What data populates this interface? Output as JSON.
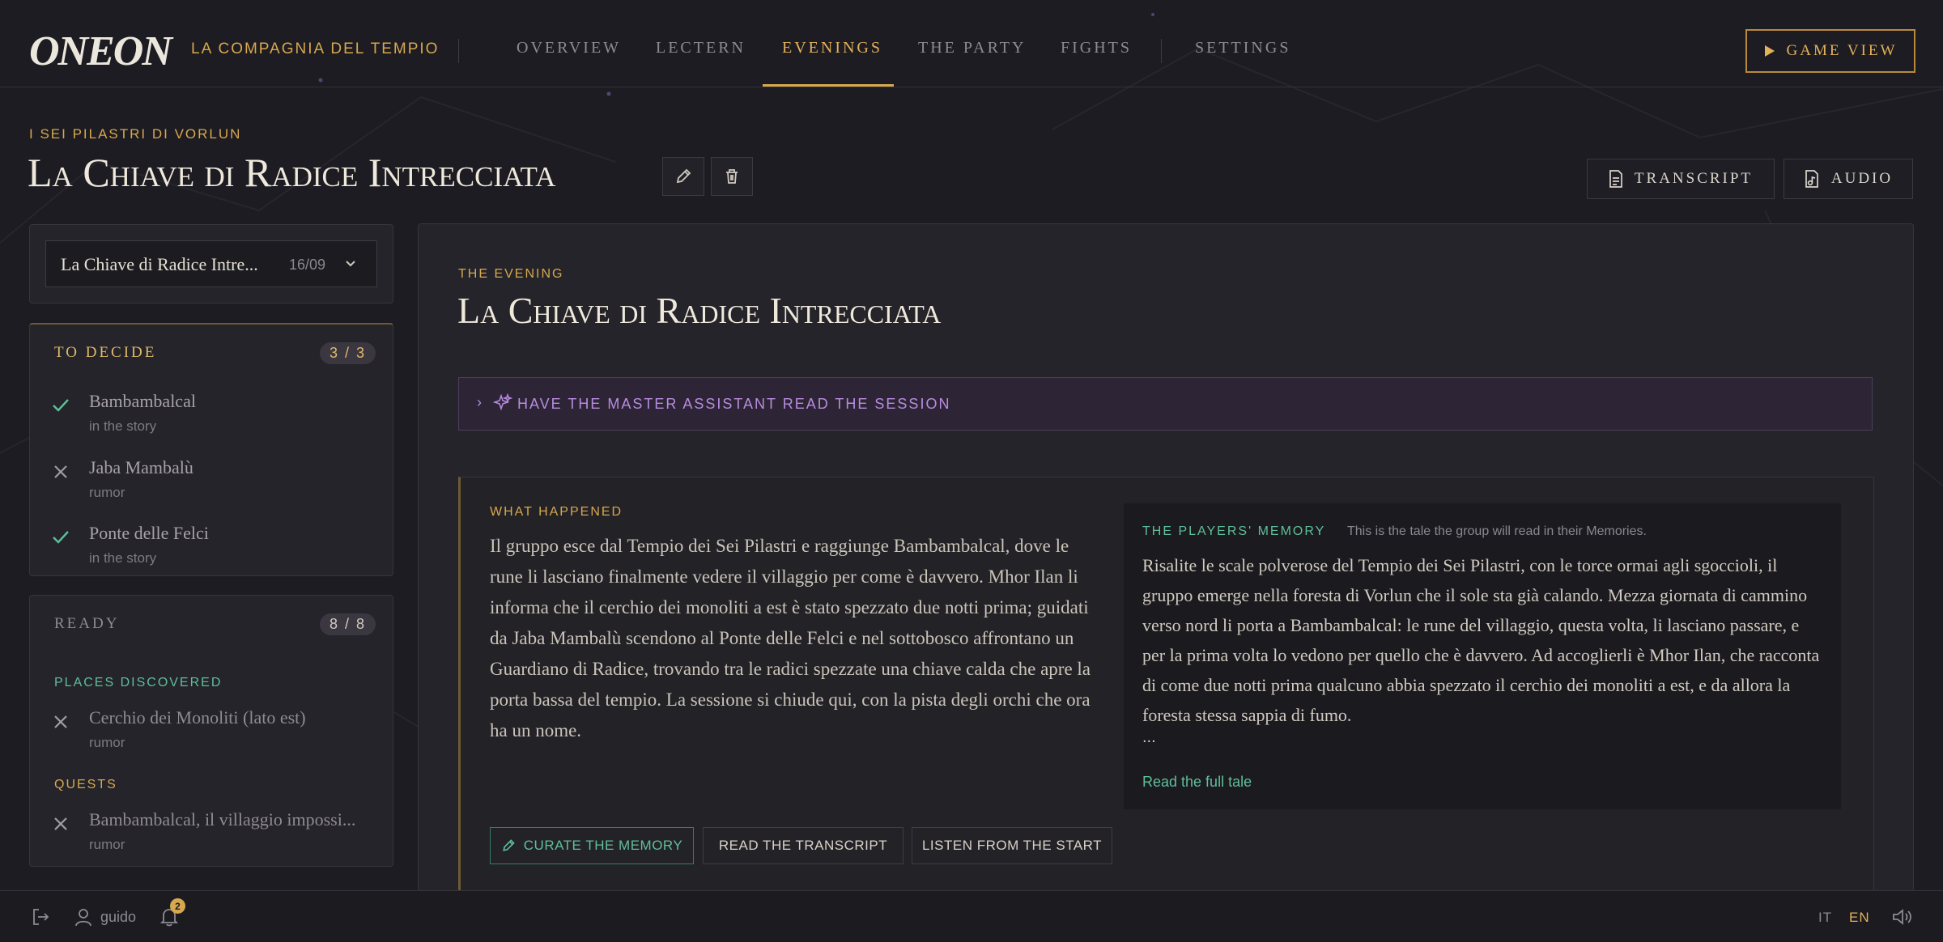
{
  "brand": {
    "logo": "ONEON",
    "campaign": "LA COMPAGNIA DEL TEMPIO"
  },
  "nav": {
    "items": [
      {
        "label": "OVERVIEW",
        "active": false
      },
      {
        "label": "LECTERN",
        "active": false
      },
      {
        "label": "EVENINGS",
        "active": true
      },
      {
        "label": "THE PARTY",
        "active": false
      },
      {
        "label": "FIGHTS",
        "active": false
      },
      {
        "label": "SETTINGS",
        "active": false
      }
    ],
    "game_view": "GAME VIEW"
  },
  "header": {
    "arc": "I SEI PILASTRI DI VORLUN",
    "title": "La Chiave di Radice Intrecciata",
    "transcript_button": "TRANSCRIPT",
    "audio_button": "AUDIO"
  },
  "session_select": {
    "value": "La Chiave di Radice Intre...",
    "date": "16/09"
  },
  "to_decide": {
    "title": "TO DECIDE",
    "count": "3 / 3",
    "items": [
      {
        "name": "Bambambalcal",
        "status": "in the story",
        "icon": "check-icon"
      },
      {
        "name": "Jaba Mambalù",
        "status": "rumor",
        "icon": "cross-icon"
      },
      {
        "name": "Ponte delle Felci",
        "status": "in the story",
        "icon": "check-icon"
      }
    ]
  },
  "ready": {
    "title": "READY",
    "count": "8 / 8",
    "places_label": "PLACES DISCOVERED",
    "places": [
      {
        "name": "Cerchio dei Monoliti (lato est)",
        "status": "rumor",
        "icon": "cross-icon"
      }
    ],
    "quests_label": "QUESTS",
    "quests": [
      {
        "name": "Bambambalcal, il villaggio impossi...",
        "status": "rumor",
        "icon": "cross-icon"
      }
    ]
  },
  "evening": {
    "label": "THE EVENING",
    "title": "La Chiave di Radice Intrecciata",
    "assistant_label": "HAVE THE MASTER ASSISTANT READ THE SESSION",
    "what_happened_label": "WHAT HAPPENED",
    "what_happened": "Il gruppo esce dal Tempio dei Sei Pilastri e raggiunge Bambambalcal, dove le rune li lasciano finalmente vedere il villaggio per come è davvero. Mhor Ilan li informa che il cerchio dei monoliti a est è stato spezzato due notti prima; guidati da Jaba Mambalù scendono al Ponte delle Felci e nel sottobosco affrontano un Guardiano di Radice, trovando tra le radici spezzate una chiave calda che apre la porta bassa del tempio. La sessione si chiude qui, con la pista degli orchi che ora ha un nome.",
    "memory_label": "THE PLAYERS' MEMORY",
    "memory_note": "This is the tale the group will read in their Memories.",
    "memory_text": "Risalite le scale polverose del Tempio dei Sei Pilastri, con le torce ormai agli sgoccioli, il gruppo emerge nella foresta di Vorlun che il sole sta già calando. Mezza giornata di cammino verso nord li porta a Bambambalcal: le rune del villaggio, questa volta, li lasciano passare, e per la prima volta lo vedono per quello che è davvero. Ad accoglierli è Mhor Ilan, che racconta di come due notti prima qualcuno abbia spezzato il cerchio dei monoliti a est, e da allora la foresta stessa sappia di fumo.",
    "ellipsis": "...",
    "read_full": "Read the full tale",
    "curate_button": "CURATE THE MEMORY",
    "read_transcript_button": "READ THE TRANSCRIPT",
    "listen_button": "LISTEN FROM THE START"
  },
  "footer": {
    "user": "guido",
    "notifications": "2",
    "lang_it": "IT",
    "lang_en": "EN"
  },
  "colors": {
    "accent": "#d7a84e",
    "teal": "#5fbf9a",
    "purple": "#b98be0",
    "background": "#1d1c22"
  }
}
